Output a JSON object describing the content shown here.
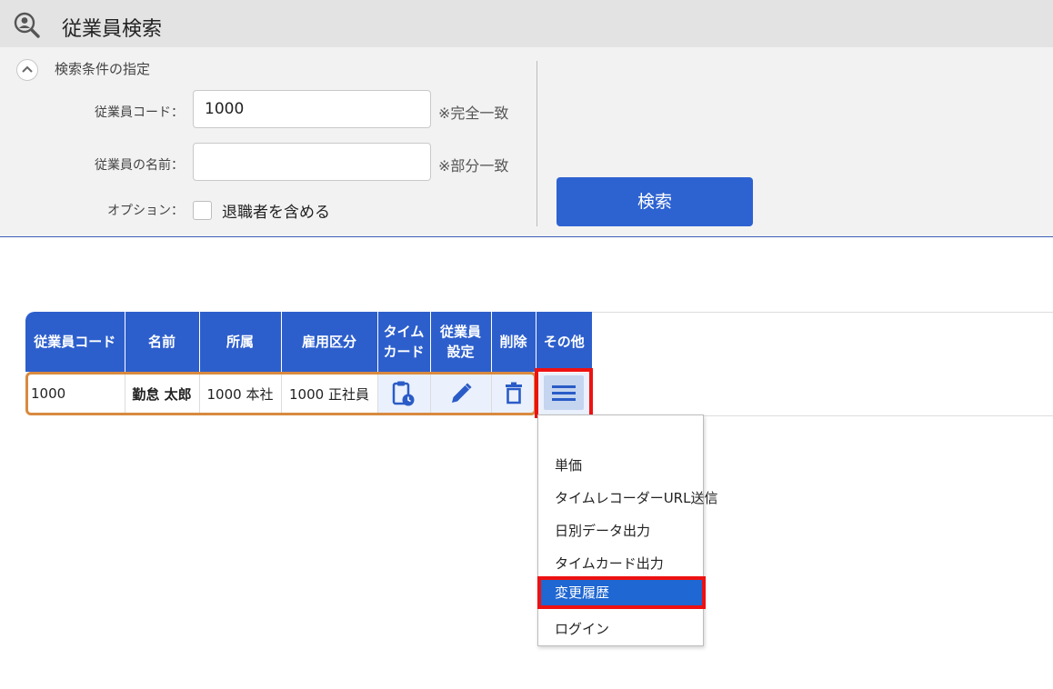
{
  "header": {
    "title": "従業員検索",
    "icon": "user-search-icon"
  },
  "search": {
    "section_title": "検索条件の指定",
    "code_label": "従業員コード：",
    "code_value": "1000",
    "code_hint": "※完全一致",
    "name_label": "従業員の名前：",
    "name_value": "",
    "name_hint": "※部分一致",
    "option_label": "オプション：",
    "retired_label": "退職者を含める",
    "retired_checked": false,
    "button_label": "検索"
  },
  "table": {
    "headers": {
      "code": "従業員コード",
      "name": "名前",
      "dept": "所属",
      "employment": "雇用区分",
      "timecard_1": "タイム",
      "timecard_2": "カード",
      "settings_1": "従業員",
      "settings_2": "設定",
      "delete": "削除",
      "other": "その他"
    },
    "rows": [
      {
        "code": "1000",
        "name": "勤怠 太郎",
        "dept": "1000 本社",
        "employment": "1000 正社員"
      }
    ]
  },
  "menu": {
    "items": [
      {
        "label": "単価"
      },
      {
        "label": "タイムレコーダーURL送信"
      },
      {
        "label": "日別データ出力"
      },
      {
        "label": "タイムカード出力"
      },
      {
        "label": "変更履歴",
        "highlighted": true
      },
      {
        "label": "ログイン"
      }
    ]
  },
  "colors": {
    "accent": "#2d62d1",
    "table_header": "#2d5fcc",
    "highlight_frame": "#ee1111",
    "row_outline": "#d88a3f",
    "menu_active": "#1f67d2"
  }
}
